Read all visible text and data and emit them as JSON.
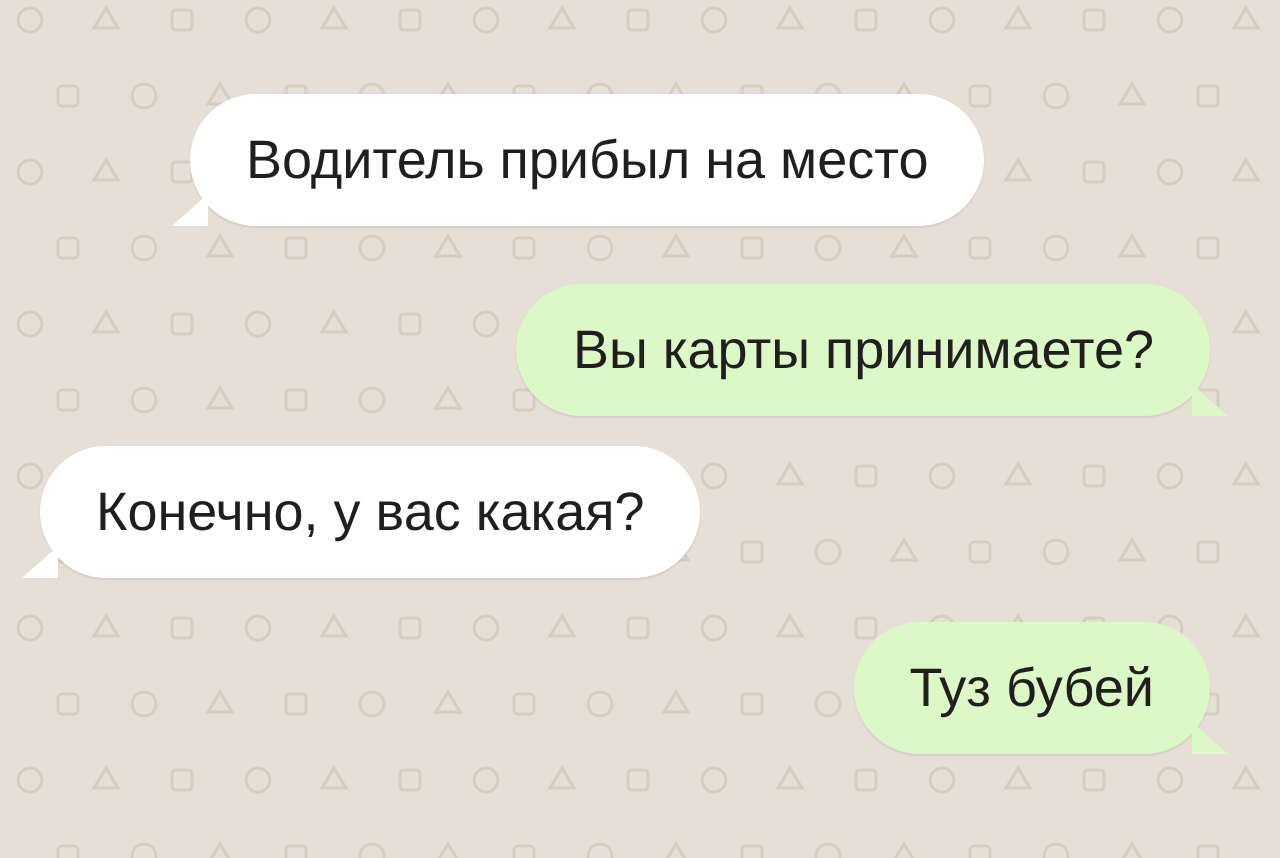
{
  "messages": [
    {
      "kind": "incoming",
      "text": "Водитель прибыл на место"
    },
    {
      "kind": "outgoing",
      "text": "Вы карты принимаете?"
    },
    {
      "kind": "incoming",
      "text": "Конечно, у вас какая?"
    },
    {
      "kind": "outgoing",
      "text": "Туз бубей"
    }
  ]
}
